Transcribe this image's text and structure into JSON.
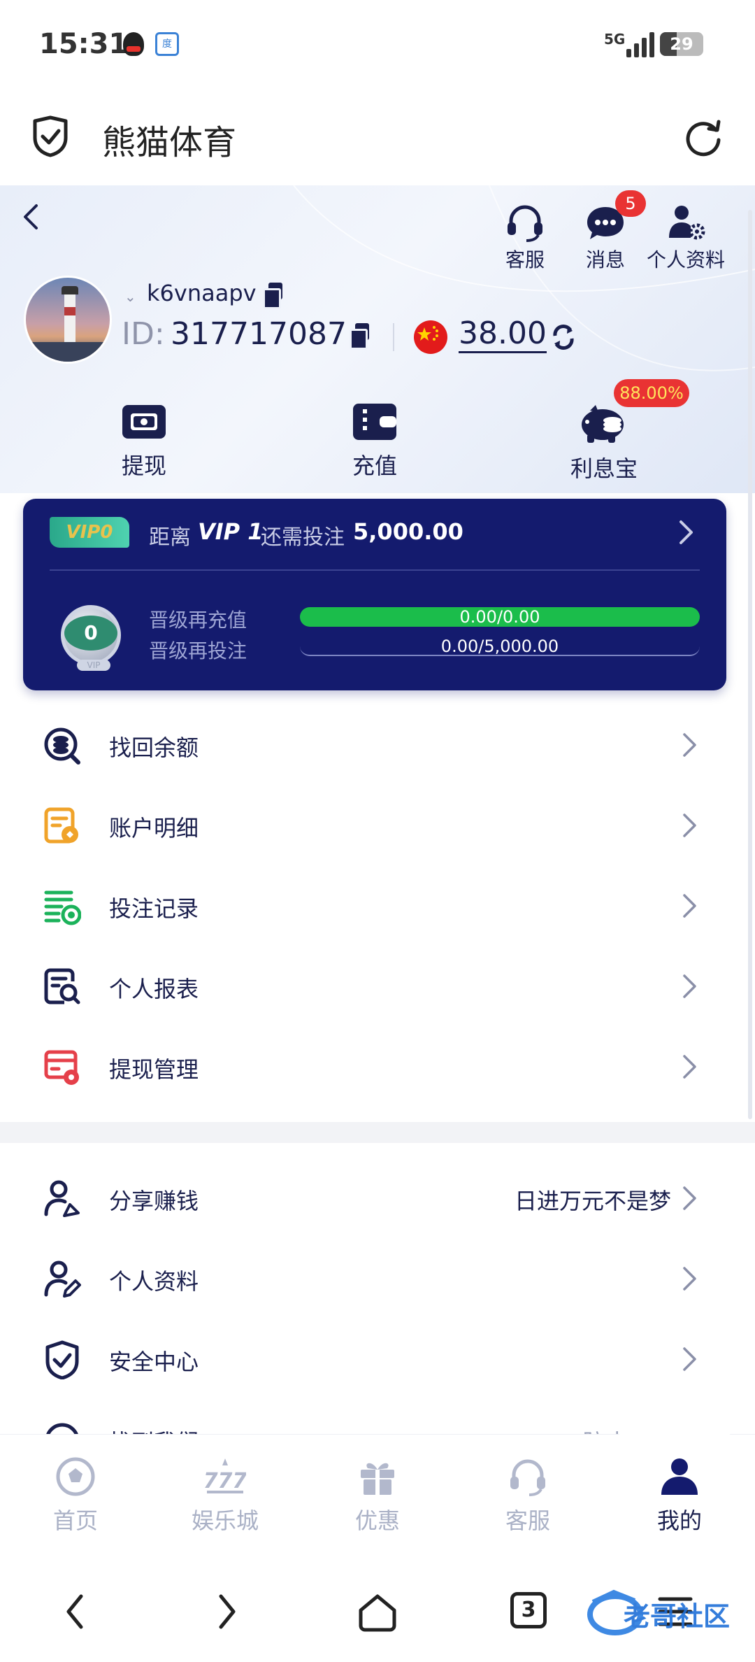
{
  "status_bar": {
    "time": "15:31",
    "network": "5G",
    "battery": "29"
  },
  "browser": {
    "title": "熊猫体育"
  },
  "header_icons": [
    {
      "label": "客服",
      "icon": "headset-icon"
    },
    {
      "label": "消息",
      "icon": "message-icon",
      "badge": "5"
    },
    {
      "label": "个人资料",
      "icon": "profile-settings-icon"
    }
  ],
  "user": {
    "username": "k6vnaapv",
    "id_label": "ID:",
    "id": "317717087",
    "balance": "38.00",
    "flag": "cn-flag-icon"
  },
  "quick_actions": [
    {
      "label": "提现",
      "icon": "withdraw-icon"
    },
    {
      "label": "充值",
      "icon": "wallet-icon"
    },
    {
      "label": "利息宝",
      "icon": "piggy-bank-icon",
      "badge": "88.00%"
    }
  ],
  "vip": {
    "tag": "VIP0",
    "prefix": "距离",
    "next_level": "VIP 1",
    "middle": "还需投注",
    "amount": "5,000.00",
    "medal_level": "0",
    "medal_label": "VIP",
    "deposit_label": "晋级再充值",
    "deposit_progress": "0.00/0.00",
    "deposit_fraction": 1.0,
    "bet_label": "晋级再投注",
    "bet_progress": "0.00/5,000.00",
    "bet_fraction": 0.0
  },
  "menu_group1": [
    {
      "label": "找回余额",
      "icon": "recover-balance-icon"
    },
    {
      "label": "账户明细",
      "icon": "account-details-icon"
    },
    {
      "label": "投注记录",
      "icon": "bet-record-icon"
    },
    {
      "label": "个人报表",
      "icon": "report-search-icon"
    },
    {
      "label": "提现管理",
      "icon": "withdraw-manage-icon"
    }
  ],
  "menu_group2": [
    {
      "label": "分享赚钱",
      "icon": "share-earn-icon",
      "right": "日进万元不是梦"
    },
    {
      "label": "个人资料",
      "icon": "profile-edit-icon"
    },
    {
      "label": "安全中心",
      "icon": "security-shield-icon"
    },
    {
      "label": "找到我们",
      "icon": "find-us-icon",
      "right": "防止打..."
    }
  ],
  "tabs": [
    {
      "label": "首页",
      "icon": "soccer-ball-icon"
    },
    {
      "label": "娱乐城",
      "icon": "slot-777-icon"
    },
    {
      "label": "优惠",
      "icon": "gift-icon"
    },
    {
      "label": "客服",
      "icon": "headset-icon"
    },
    {
      "label": "我的",
      "icon": "user-icon",
      "active": true
    }
  ],
  "system_nav": {
    "tab_count": "3"
  },
  "watermark": "老哥社区 LAOGESHEQU",
  "colors": {
    "navy": "#141b6e",
    "accent_green": "#1bbd4b",
    "badge_red": "#e93333"
  }
}
